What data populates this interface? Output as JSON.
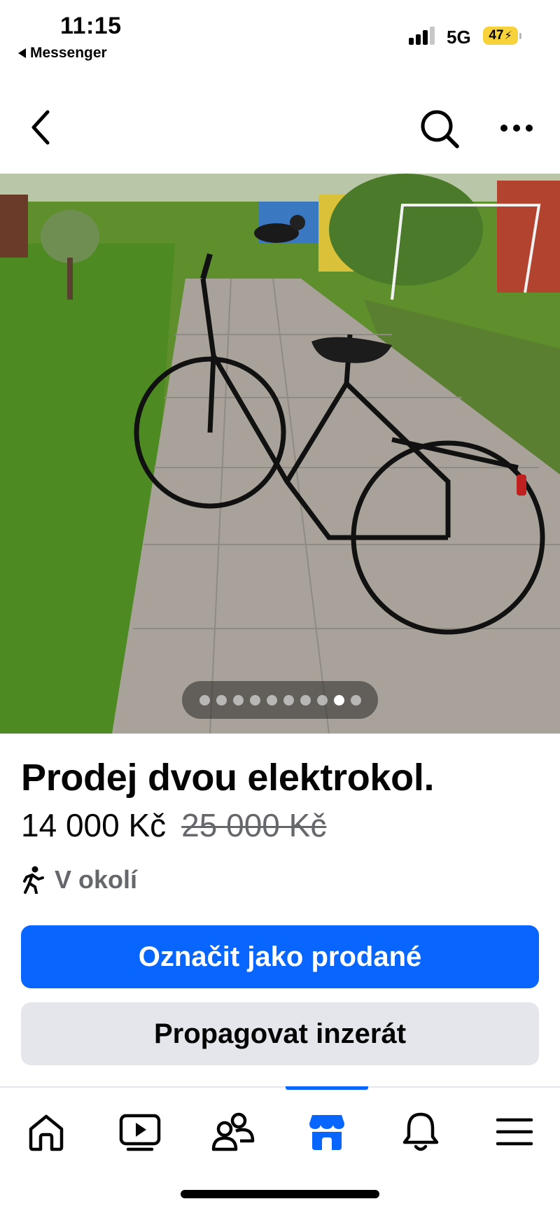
{
  "status_bar": {
    "time": "11:15",
    "back_app": "Messenger",
    "network": "5G",
    "battery": "47"
  },
  "topnav": {
    "back_icon": "chevron-left-icon",
    "search_icon": "search-icon",
    "more_icon": "more-horizontal-icon"
  },
  "photo": {
    "description_icon": "listing-photo",
    "pages_total": 10,
    "current_page": 9
  },
  "listing": {
    "title": "Prodej dvou elektrokol.",
    "price": "14 000 Kč",
    "original_price": "25 000 Kč",
    "location": "V okolí"
  },
  "actions": {
    "mark_sold": "Označit jako prodané",
    "promote": "Propagovat inzerát"
  },
  "tabbar": {
    "tabs": [
      "home-icon",
      "video-icon",
      "friends-icon",
      "marketplace-icon",
      "notifications-icon",
      "menu-icon"
    ],
    "active": "marketplace-icon"
  },
  "colors": {
    "accent": "#0866ff",
    "secondary_button": "#e4e6eb",
    "muted_text": "#65676b"
  }
}
